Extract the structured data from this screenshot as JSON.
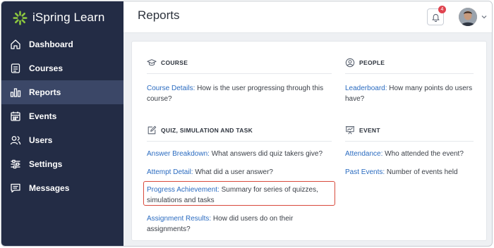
{
  "app": {
    "name": "iSpring Learn",
    "brand_color": "#8bc53f"
  },
  "sidebar": {
    "items": [
      {
        "label": "Dashboard",
        "icon": "home-icon"
      },
      {
        "label": "Courses",
        "icon": "courses-icon"
      },
      {
        "label": "Reports",
        "icon": "reports-icon",
        "active": true
      },
      {
        "label": "Events",
        "icon": "calendar-icon"
      },
      {
        "label": "Users",
        "icon": "users-icon"
      },
      {
        "label": "Settings",
        "icon": "settings-sliders-icon"
      },
      {
        "label": "Messages",
        "icon": "messages-icon"
      }
    ]
  },
  "header": {
    "title": "Reports",
    "notifications_count": "4"
  },
  "sections": {
    "course": {
      "title": "COURSE",
      "icon": "graduation-cap-icon",
      "items": [
        {
          "link": "Course Details:",
          "text": " How is the user progressing through this course?"
        }
      ]
    },
    "people": {
      "title": "PEOPLE",
      "icon": "person-circle-icon",
      "items": [
        {
          "link": "Leaderboard:",
          "text": " How many points do users have?"
        }
      ]
    },
    "quiz": {
      "title": "QUIZ, SIMULATION AND TASK",
      "icon": "edit-icon",
      "items": [
        {
          "link": "Answer Breakdown:",
          "text": " What answers did quiz takers give?"
        },
        {
          "link": "Attempt Detail:",
          "text": " What did a user answer?"
        },
        {
          "link": "Progress Achievement:",
          "text": " Summary for series of quizzes, simulations and tasks",
          "highlighted": true
        },
        {
          "link": "Assignment Results:",
          "text": " How did users do on their assignments?"
        }
      ]
    },
    "event": {
      "title": "EVENT",
      "icon": "presentation-icon",
      "items": [
        {
          "link": "Attendance:",
          "text": " Who attended the event?"
        },
        {
          "link": "Past Events:",
          "text": " Number of events held"
        }
      ]
    }
  },
  "colors": {
    "sidebar_bg": "#232c45",
    "sidebar_active": "#3b4767",
    "link": "#2a6bc0",
    "highlight_border": "#d84a3c",
    "badge": "#e0434f"
  }
}
